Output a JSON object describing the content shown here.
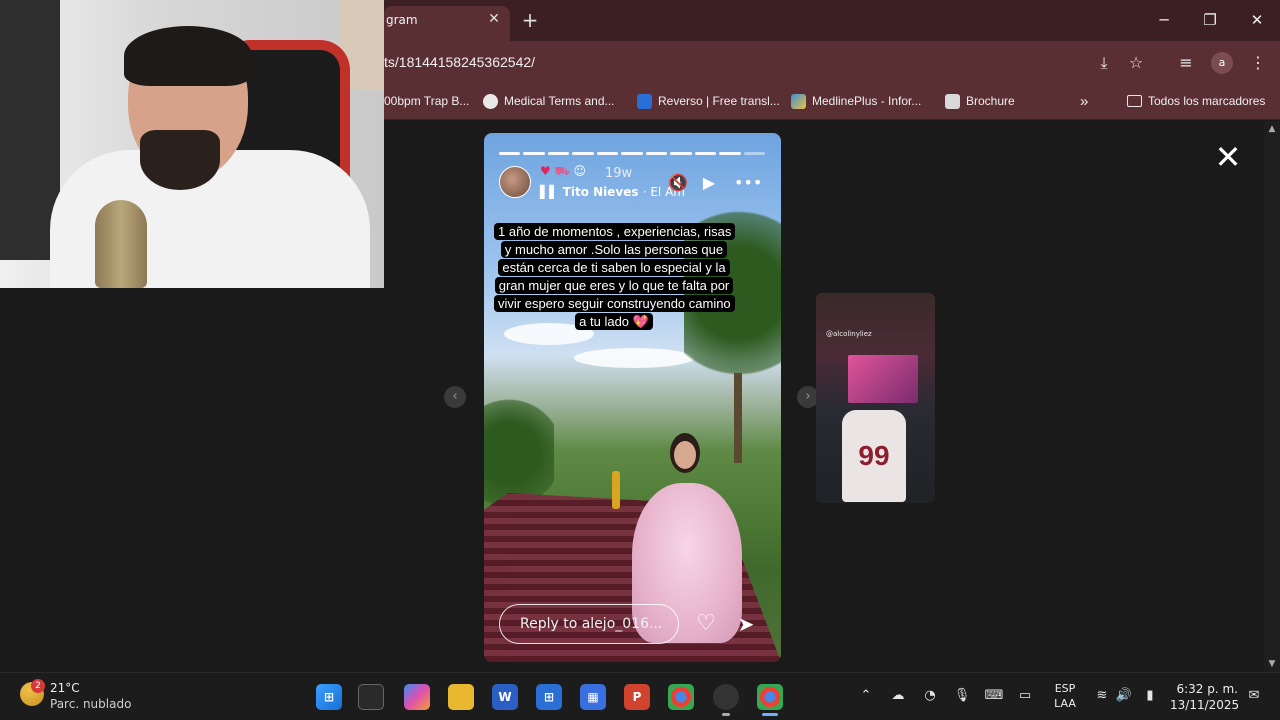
{
  "browser": {
    "tab_title": "gram",
    "tab_close": "✕",
    "new_tab": "+",
    "url": "ts/18144158245362542/",
    "window_controls": {
      "minimize": "─",
      "restore": "❐",
      "close": "✕"
    },
    "profile_initial": "a",
    "bookmarks": [
      {
        "label": "00bpm Trap B...",
        "icon": "music-icon"
      },
      {
        "label": "Medical Terms and...",
        "icon": "medical-icon"
      },
      {
        "label": "Reverso | Free transl...",
        "icon": "reverso-icon"
      },
      {
        "label": "MedlinePlus - Infor...",
        "icon": "medlineplus-icon"
      },
      {
        "label": "Brochure",
        "icon": "brochure-icon"
      }
    ],
    "bookmarks_overflow": "»",
    "all_bookmarks_label": "Todos los marcadores"
  },
  "story": {
    "time_ago": "19w",
    "music_artist": "Tito Nieves",
    "music_song": "· El Am",
    "caption": "1 año de momentos , experiencias, risas y mucho amor .Solo las personas que están cerca de ti saben lo especial y la gran mujer que eres y lo que te falta por vivir espero seguir construyendo camino a tu lado 💖",
    "reply_placeholder": "Reply to alejo_016...",
    "progress_segments": 11,
    "progress_active": 10
  },
  "next_story": {
    "username": "@alcolinyliez",
    "jersey_number": "99"
  },
  "taskbar": {
    "weather_badge": "2",
    "temperature": "21°C",
    "weather_desc": "Parc. nublado",
    "lang_top": "ESP",
    "lang_bottom": "LAA",
    "time": "6:32 p. m.",
    "date": "13/11/2025"
  },
  "colors": {
    "tabstrip": "#3b1f22",
    "toolbar": "#5a2f33",
    "page_bg": "#1a1a1a",
    "taskbar": "#1c1c1c"
  }
}
